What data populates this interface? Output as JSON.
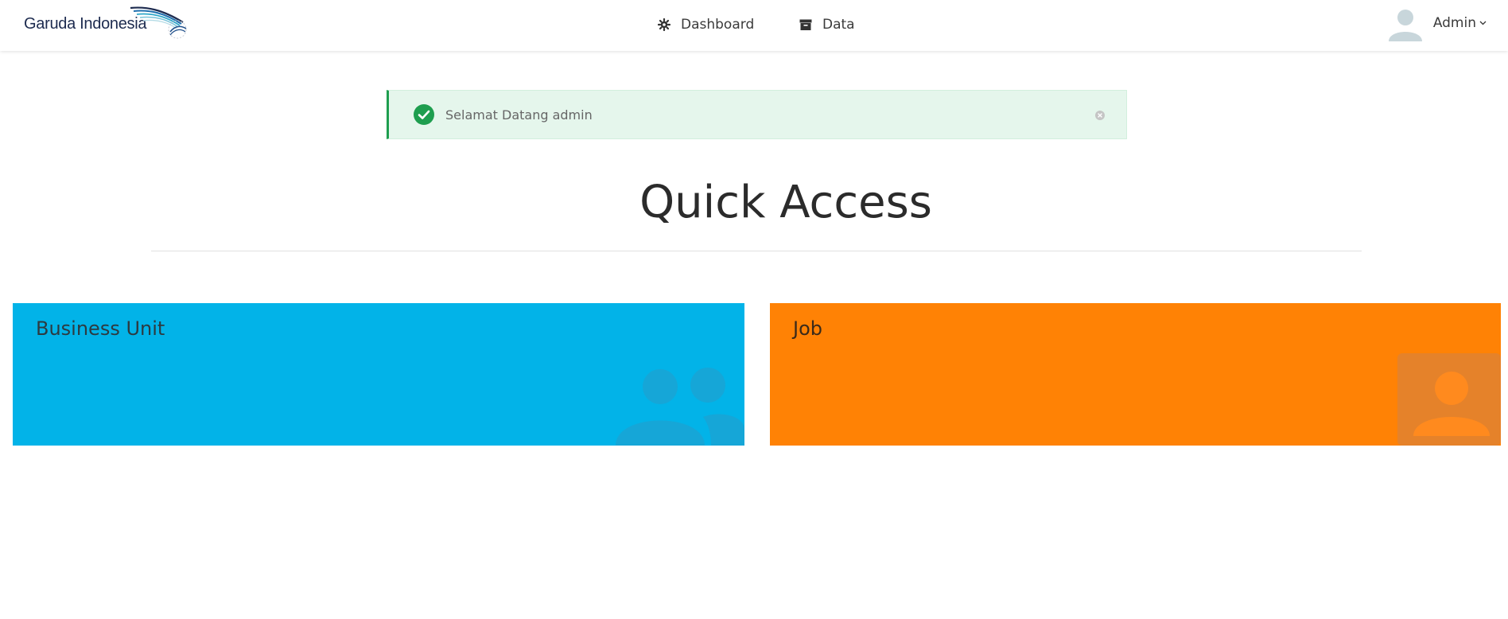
{
  "brand": {
    "name": "Garuda Indonesia"
  },
  "nav": {
    "dashboard_label": "Dashboard",
    "data_label": "Data"
  },
  "user": {
    "name": "Admin"
  },
  "alert": {
    "message": "Selamat Datang admin",
    "type": "success"
  },
  "page": {
    "title": "Quick Access"
  },
  "tiles": [
    {
      "label": "Business Unit",
      "color": "#02b3e8",
      "icon": "users-icon"
    },
    {
      "label": "Job",
      "color": "#ff8205",
      "icon": "user-icon"
    }
  ],
  "colors": {
    "success": "#1e9e4f",
    "success_bg": "#e5f6ec",
    "brand_navy": "#1d2b4f"
  }
}
